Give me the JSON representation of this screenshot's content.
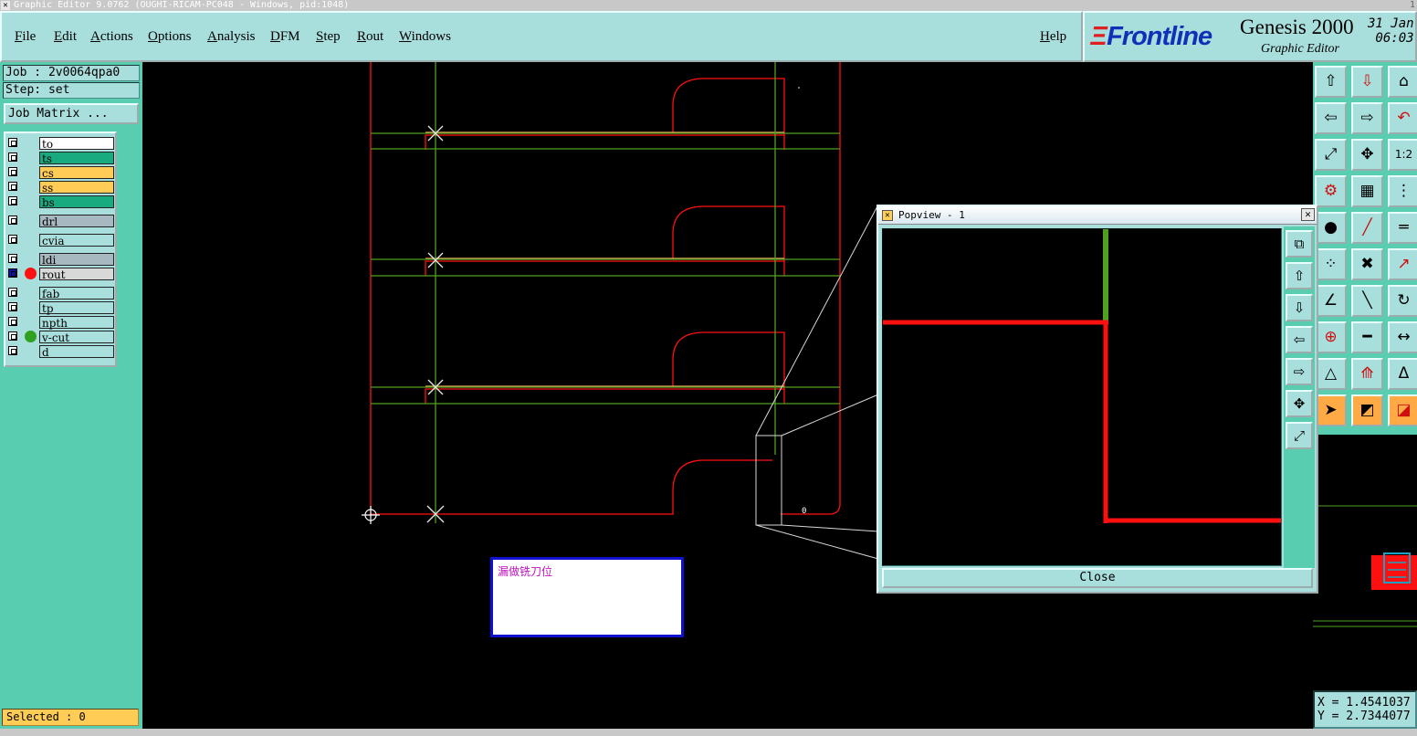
{
  "window": {
    "title": "Graphic Editor 9.0762 (OUGHI-RICAM-PC048 - Windows, pid:1048)",
    "title_right": "1"
  },
  "menu": {
    "items": [
      "File",
      "Edit",
      "Actions",
      "Options",
      "Analysis",
      "DFM",
      "Step",
      "Rout",
      "Windows"
    ],
    "help": "Help"
  },
  "brand": {
    "logo": "Frontline",
    "product": "Genesis 2000",
    "subtitle": "Graphic Editor",
    "date_line1": "31 Jan",
    "date_line2": "06:03"
  },
  "job": {
    "job_label": "Job : 2v0064qpa0",
    "step_label": "Step: set",
    "matrix_button": "Job Matrix ..."
  },
  "layers": [
    {
      "name": "to",
      "color": "#ffffff",
      "dot": null
    },
    {
      "name": "ts",
      "color": "#1aaa80",
      "dot": null
    },
    {
      "name": "cs",
      "color": "#ffcc55",
      "dot": null
    },
    {
      "name": "ss",
      "color": "#ffcc55",
      "dot": null
    },
    {
      "name": "bs",
      "color": "#1aaa80",
      "dot": null
    },
    {
      "name": "drl",
      "color": "#a8b8c0",
      "dot": null
    },
    {
      "name": "cvia",
      "color": "#a8dedc",
      "dot": null
    },
    {
      "name": "ldi",
      "color": "#a8b8c0",
      "dot": null
    },
    {
      "name": "rout",
      "color": "#d8d8d8",
      "dot": "#ff1010"
    },
    {
      "name": "fab",
      "color": "#a8dedc",
      "dot": null
    },
    {
      "name": "tp",
      "color": "#a8dedc",
      "dot": null
    },
    {
      "name": "npth",
      "color": "#a8dedc",
      "dot": null
    },
    {
      "name": "v-cut",
      "color": "#a8dedc",
      "dot": "#30a020"
    },
    {
      "name": "d",
      "color": "#a8dedc",
      "dot": null
    }
  ],
  "status": {
    "selected": "Selected : 0"
  },
  "coords": {
    "x": "X = 1.4541037",
    "y": "Y = 2.7344077"
  },
  "popview": {
    "title": "Popview - 1",
    "close_label": "Close"
  },
  "note": {
    "text": "漏做铣刀位"
  },
  "canvas": {
    "marker_label": "0"
  },
  "colors": {
    "panel": "#58cdb0",
    "widget": "#a8dedc",
    "rout_line": "#ff1010",
    "vcut_line": "#50a020",
    "cs_line": "#f0b060"
  },
  "tools": [
    "move-up-icon",
    "move-down-icon",
    "home-icon",
    "move-left-icon",
    "move-right-icon",
    "undo-icon",
    "zoom-fit-icon",
    "zoom-center-icon",
    "scale-1to2-icon",
    "measure-icon",
    "grid-icon",
    "net-icon",
    "pad-icon",
    "line-icon",
    "ruler-icon",
    "connect-icon",
    "cross-icon",
    "arrow-icon",
    "angle-icon",
    "slash-icon",
    "rotate-icon",
    "pad-add-icon",
    "segment-icon",
    "dimension-icon",
    "triangle-icon",
    "triangle-split-icon",
    "triangle-a-icon",
    "select-arrow-icon",
    "select-box-icon",
    "select-arc-icon"
  ],
  "popview_tools": [
    "zoom-window-icon",
    "pan-up-icon",
    "pan-down-icon",
    "pan-left-icon",
    "pan-right-icon",
    "zoom-in-icon",
    "zoom-out-icon"
  ]
}
